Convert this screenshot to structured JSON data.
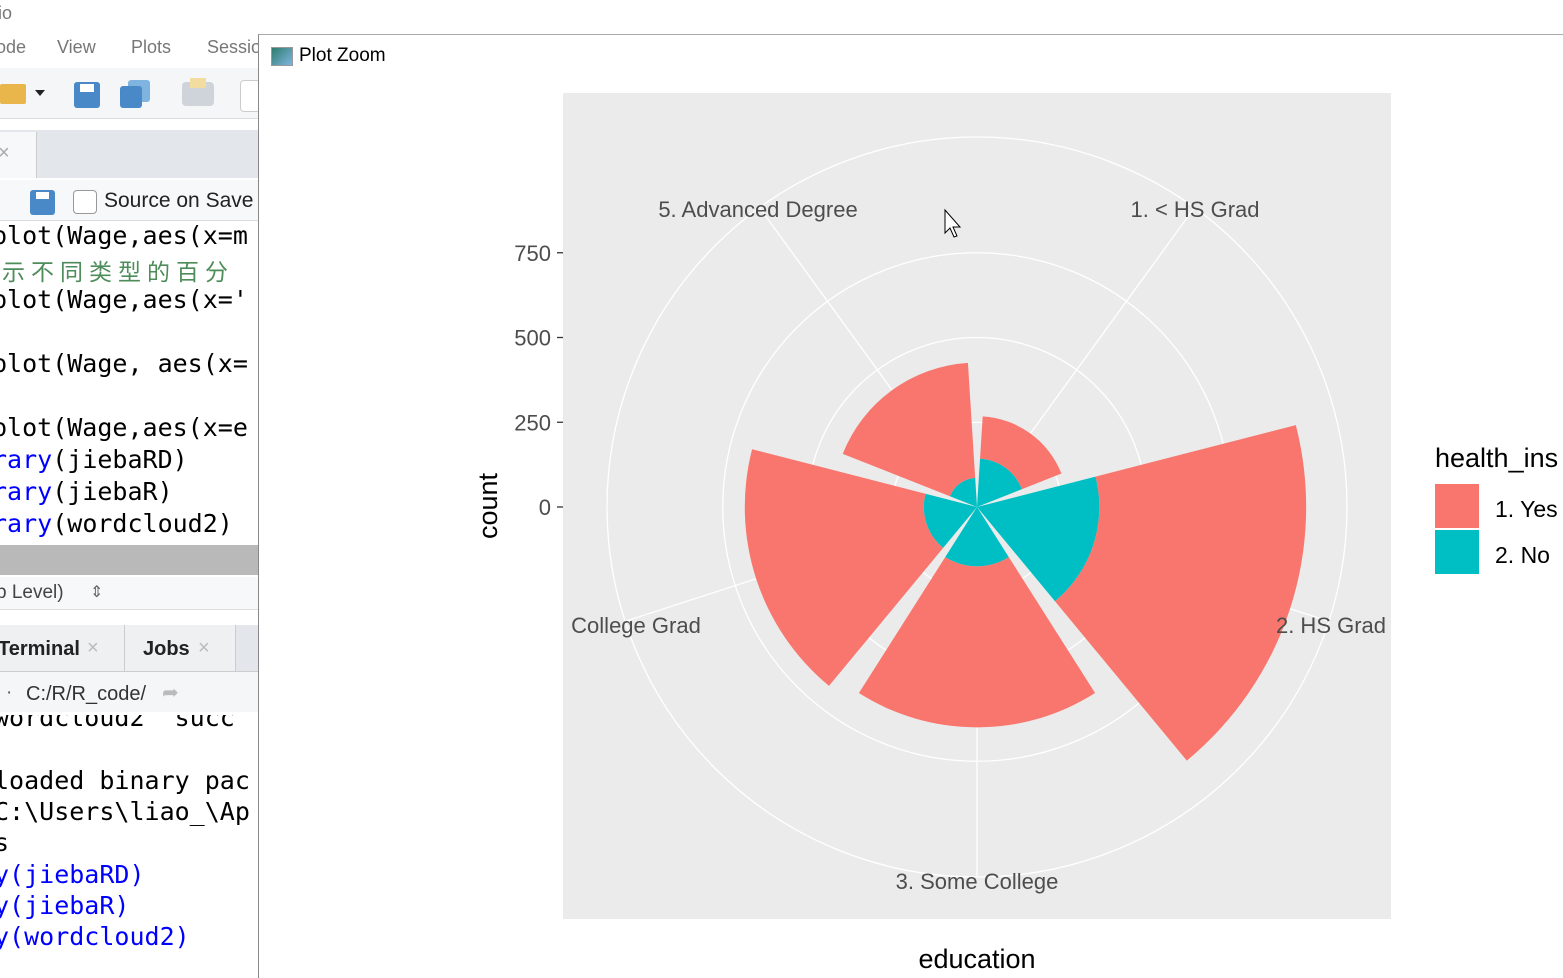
{
  "rstudio": {
    "title_fragment": "io",
    "menu": [
      "ode",
      "View",
      "Plots",
      "Sessio"
    ],
    "editor": {
      "source_on_save_label": "Source on Save",
      "source_on_save_checked": false,
      "code_lines": [
        {
          "text": "plot(Wage,aes(x=m",
          "kind": "code"
        },
        {
          "text": "示不同类型的百分",
          "kind": "comment"
        },
        {
          "text": "plot(Wage,aes(x='",
          "kind": "code"
        },
        {
          "text": "",
          "kind": "code"
        },
        {
          "text": "plot(Wage, aes(x=",
          "kind": "code"
        },
        {
          "text": "",
          "kind": "code"
        },
        {
          "text": "plot(Wage,aes(x=e",
          "kind": "code"
        },
        {
          "text": "rary",
          "rest": "(jiebaRD)",
          "kind": "lib"
        },
        {
          "text": "rary",
          "rest": "(jiebaR)",
          "kind": "lib"
        },
        {
          "text": "rary",
          "rest": "(wordcloud2)",
          "kind": "lib"
        }
      ],
      "scope_label": "p Level)"
    },
    "console": {
      "tabs": [
        {
          "label": "Terminal"
        },
        {
          "label": "Jobs"
        }
      ],
      "path": "C:/R/R_code/",
      "lines": [
        {
          "text": "wordcloud2' succ",
          "blue": false
        },
        {
          "text": "",
          "blue": false
        },
        {
          "text": "loaded binary pac",
          "blue": false
        },
        {
          "text": "C:\\Users\\liao_\\Ap",
          "blue": false
        },
        {
          "text": "s",
          "blue": false
        },
        {
          "text": "y(jiebaRD)",
          "blue": true
        },
        {
          "text": "y(jiebaR)",
          "blue": true
        },
        {
          "text": "y(wordcloud2)",
          "blue": true
        }
      ]
    }
  },
  "plot_window": {
    "title": "Plot Zoom"
  },
  "chart_data": {
    "type": "bar",
    "coord": "polar",
    "position": "stack",
    "categories": [
      "1. < HS Grad",
      "2. HS Grad",
      "3. Some College",
      "4. College Grad",
      "5. Advanced Degree"
    ],
    "category_labels_shown": [
      "1. < HS Grad",
      "2. HS Grad",
      "3. Some College",
      "College Grad",
      "5. Advanced Degree"
    ],
    "series": [
      {
        "name": "1. Yes",
        "color": "#F8766D",
        "values": [
          125,
          610,
          475,
          528,
          340
        ]
      },
      {
        "name": "2. No",
        "color": "#00BFC4",
        "values": [
          143,
          361,
          175,
          157,
          86
        ]
      }
    ],
    "xlabel": "education",
    "ylabel": "count",
    "y_ticks": [
      0,
      250,
      500,
      750
    ],
    "legend": {
      "title": "health_ins",
      "position": "right"
    },
    "grid": true,
    "panel_background": "#EBEBEB"
  }
}
